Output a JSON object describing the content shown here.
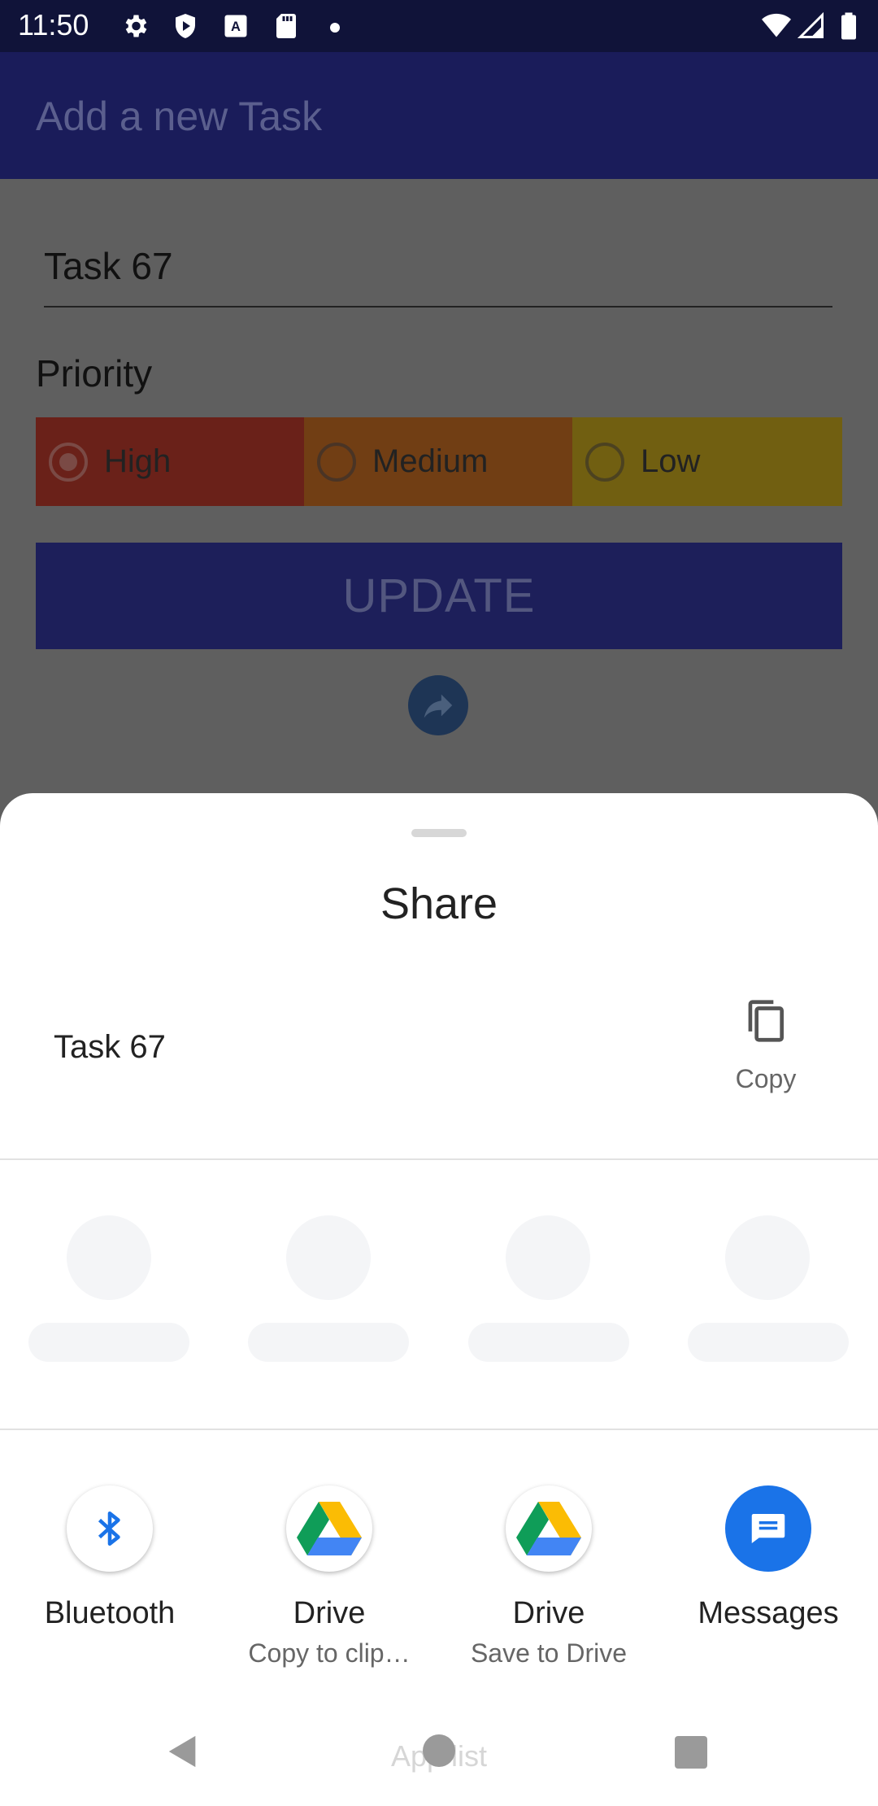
{
  "status_bar": {
    "time": "11:50",
    "left_icons": [
      "gear-icon",
      "shield-icon",
      "a-box-icon",
      "sdcard-icon",
      "dot-icon"
    ],
    "right_icons": [
      "wifi-icon",
      "signal-icon",
      "battery-icon"
    ]
  },
  "app": {
    "title": "Add a new Task",
    "task_name": "Task 67",
    "priority_label": "Priority",
    "priorities": [
      {
        "label": "High",
        "selected": true,
        "color": "#6a2119"
      },
      {
        "label": "Medium",
        "selected": false,
        "color": "#713e14"
      },
      {
        "label": "Low",
        "selected": false,
        "color": "#715f11"
      }
    ],
    "update_label": "UPDATE",
    "accent_color": "#1a1c5a"
  },
  "share_sheet": {
    "title": "Share",
    "shared_text": "Task 67",
    "copy_label": "Copy",
    "apps": [
      {
        "label": "Bluetooth",
        "sublabel": "",
        "icon": "bluetooth-icon"
      },
      {
        "label": "Drive",
        "sublabel": "Copy to clip…",
        "icon": "google-drive-icon"
      },
      {
        "label": "Drive",
        "sublabel": "Save to Drive",
        "icon": "google-drive-icon"
      },
      {
        "label": "Messages",
        "sublabel": "",
        "icon": "messages-icon"
      }
    ],
    "app_list_label": "App list"
  },
  "nav_bar": {
    "icons": [
      "back-icon",
      "home-icon",
      "recents-icon"
    ]
  }
}
